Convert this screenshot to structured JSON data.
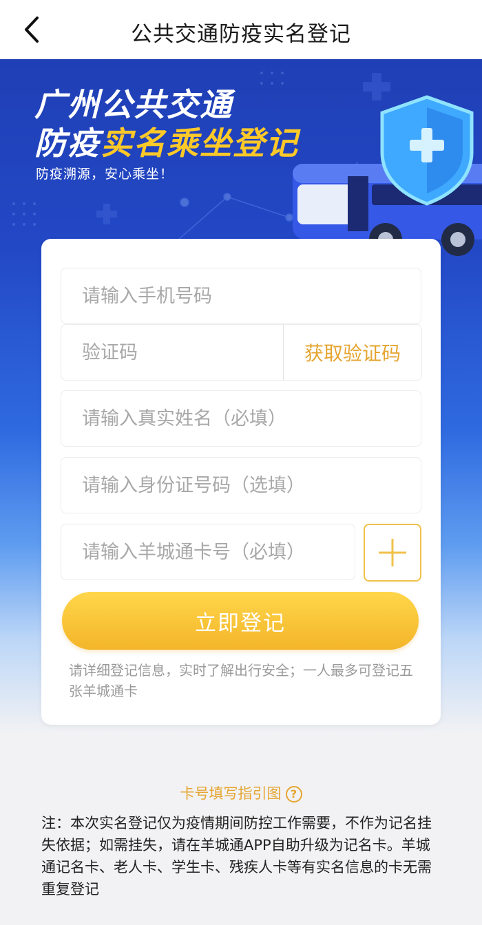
{
  "nav": {
    "title": "公共交通防疫实名登记",
    "back_icon": "chevron-left-icon"
  },
  "banner": {
    "title_line1": "广州公共交通",
    "title_line2_part1": "防疫",
    "title_line2_part2": "实名乘坐登记",
    "subtitle": "防疫溯源，安心乘坐！",
    "accent_color": "#ffc928",
    "icons": [
      "shield-plus-icon",
      "bus-icon"
    ]
  },
  "form": {
    "phone": {
      "placeholder": "请输入手机号码",
      "value": ""
    },
    "code": {
      "placeholder": "验证码",
      "value": "",
      "button_label": "获取验证码"
    },
    "name": {
      "placeholder": "请输入真实姓名（必填）",
      "value": ""
    },
    "id_number": {
      "placeholder": "请输入身份证号码（选填）",
      "value": ""
    },
    "card_number": {
      "placeholder": "请输入羊城通卡号（必填）",
      "value": ""
    },
    "add_icon": "plus-icon",
    "submit_label": "立即登记",
    "tip": "请详细登记信息，实时了解出行安全；一人最多可登记五张羊城通卡"
  },
  "guide": {
    "label": "卡号填写指引图",
    "icon": "question-circle-icon",
    "icon_glyph": "?"
  },
  "note": "注：本次实名登记仅为疫情期间防控工作需要，不作为记名挂失依据；如需挂失，请在羊城通APP自助升级为记名卡。羊城通记名卡、老人卡、学生卡、残疾人卡等有实名信息的卡无需重复登记",
  "colors": {
    "primary_blue": "#2348c6",
    "button_yellow": "#f4b52a",
    "link_orange": "#e5a531"
  }
}
